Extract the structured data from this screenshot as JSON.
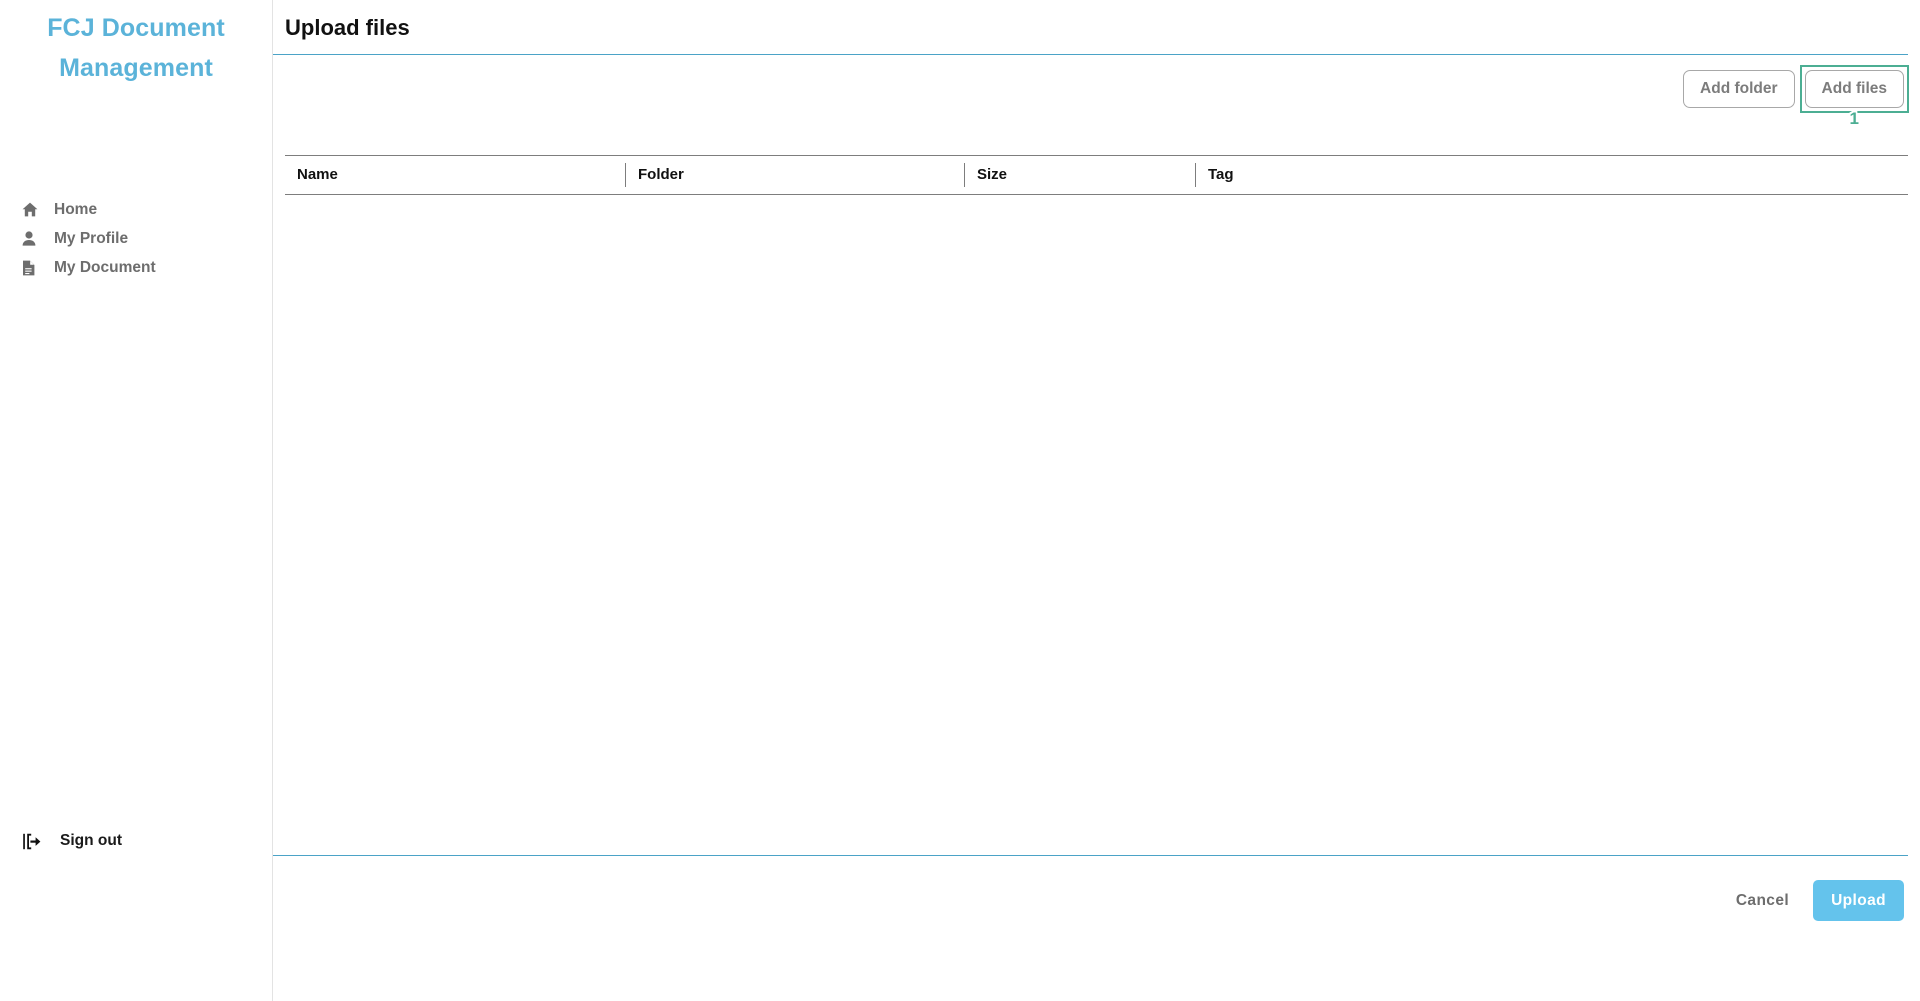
{
  "sidebar": {
    "brand": "FCJ Document Management",
    "items": [
      {
        "label": "Home",
        "icon": "home-icon"
      },
      {
        "label": "My Profile",
        "icon": "person-icon"
      },
      {
        "label": "My Document",
        "icon": "document-icon"
      }
    ],
    "signout": {
      "label": "Sign out",
      "icon": "logout-icon"
    }
  },
  "header": {
    "title": "Upload files"
  },
  "toolbar": {
    "add_folder_label": "Add folder",
    "add_files_label": "Add files",
    "annotation_number": "1"
  },
  "table": {
    "columns": [
      "Name",
      "Folder",
      "Size",
      "Tag"
    ],
    "rows": []
  },
  "footer": {
    "cancel_label": "Cancel",
    "upload_label": "Upload"
  },
  "colors": {
    "brand": "#5bb3d9",
    "divider": "#4ba3c7",
    "primary_button": "#64c3ec",
    "annotation": "#4cae93",
    "nav_text": "#6d6d6d"
  }
}
